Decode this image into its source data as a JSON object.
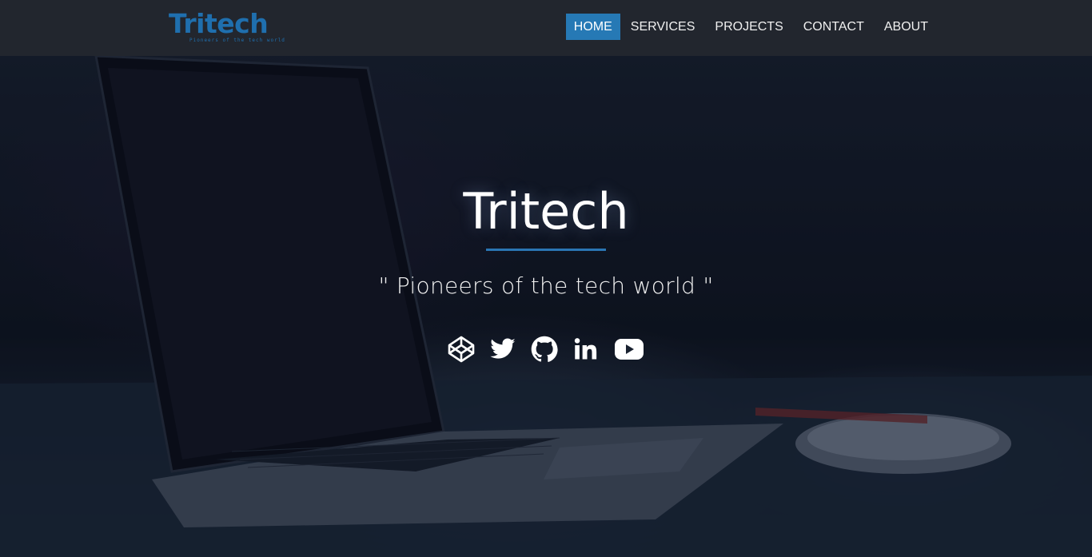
{
  "brand": {
    "name": "Tritech",
    "tagline": "Pioneers of the tech world",
    "color": "#1f6fae"
  },
  "nav": {
    "items": [
      {
        "label": "HOME",
        "active": true
      },
      {
        "label": "SERVICES",
        "active": false
      },
      {
        "label": "PROJECTS",
        "active": false
      },
      {
        "label": "CONTACT",
        "active": false
      },
      {
        "label": "ABOUT",
        "active": false
      }
    ],
    "active_color": "#2679b5"
  },
  "hero": {
    "title": "Tritech",
    "tagline": "\" Pioneers of the tech world \"",
    "accent_color": "#2a75b3",
    "social_icons": [
      "codepen-icon",
      "twitter-icon",
      "github-icon",
      "linkedin-icon",
      "youtube-icon"
    ]
  }
}
